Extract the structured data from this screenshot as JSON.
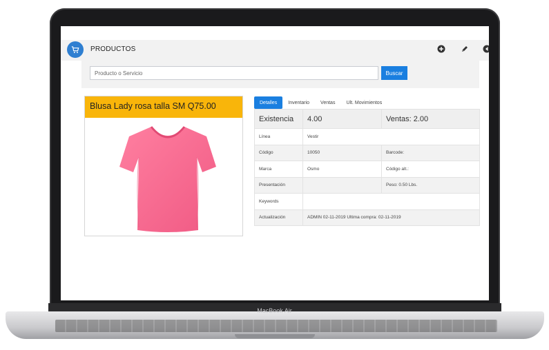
{
  "device": {
    "label": "MacBook Air"
  },
  "app": {
    "title": "PRODUCTOS",
    "toolbar": {
      "add_icon": "plus-circle-icon",
      "edit_icon": "pencil-icon",
      "back_icon": "back-circle-icon"
    }
  },
  "search": {
    "placeholder": "Producto o Servicio",
    "value": "",
    "button_label": "Buscar"
  },
  "product": {
    "title": "Blusa Lady rosa talla SM Q75.00",
    "image": "pink-tshirt",
    "header_color": "#f9b50a"
  },
  "tabs": [
    {
      "label": "Detalles",
      "active": true
    },
    {
      "label": "Inventario",
      "active": false
    },
    {
      "label": "Ventas",
      "active": false
    },
    {
      "label": "Ult. Movimientos",
      "active": false
    }
  ],
  "details": {
    "existencia_label": "Existencia",
    "existencia_value": "4.00",
    "ventas": "Ventas: 2.00",
    "rows": [
      {
        "label": "Línea",
        "value": "Vestir",
        "extra": ""
      },
      {
        "label": "Código",
        "value": "10050",
        "extra": "Barcode:"
      },
      {
        "label": "Marca",
        "value": "Osmo",
        "extra": "Código alt.:"
      },
      {
        "label": "Presentación",
        "value": "",
        "extra": "Peso: 0.50 Lbs."
      },
      {
        "label": "Keywords",
        "value": "",
        "extra": ""
      },
      {
        "label": "Actualización",
        "value": "ADMIN 02-11-2019 Ultima compra: 02-11-2019",
        "extra": ""
      }
    ]
  },
  "colors": {
    "accent": "#1a7fe0",
    "toolbar_bg": "#f2f2f2"
  }
}
